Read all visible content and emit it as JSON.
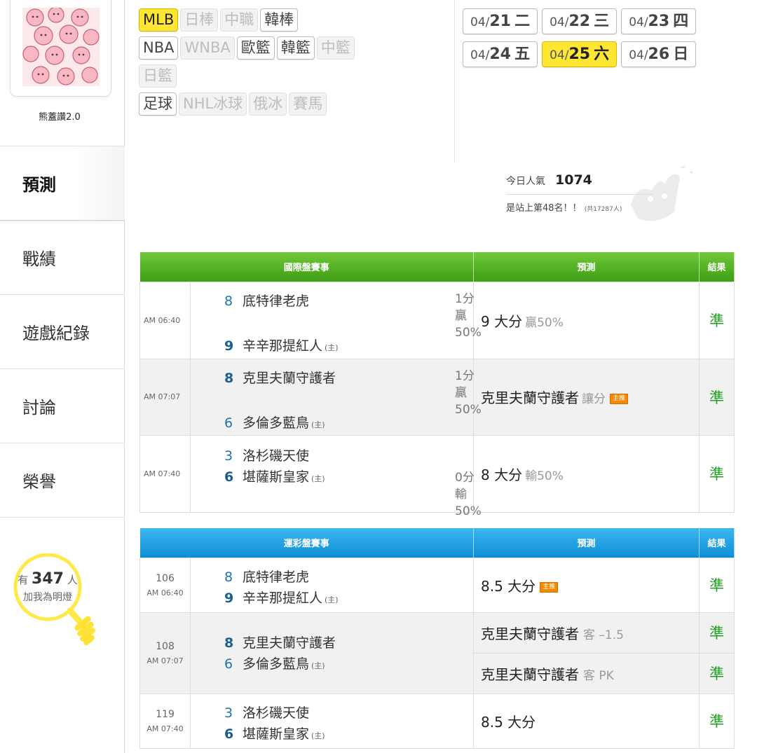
{
  "sidebar": {
    "username": "熊蓋讚2.0",
    "nav": [
      "預測",
      "戰績",
      "遊戲紀錄",
      "討論",
      "榮譽"
    ],
    "fans": {
      "prefix": "有",
      "count": "347",
      "suffix": "人",
      "line2": "加我為明燈"
    }
  },
  "leagues": [
    [
      {
        "label": "MLB",
        "state": "active"
      },
      {
        "label": "日棒",
        "state": "disabled"
      },
      {
        "label": "中職",
        "state": "disabled"
      },
      {
        "label": "韓棒",
        "state": "normal"
      }
    ],
    [
      {
        "label": "NBA",
        "state": "normal"
      },
      {
        "label": "WNBA",
        "state": "disabled"
      },
      {
        "label": "歐籃",
        "state": "normal"
      },
      {
        "label": "韓籃",
        "state": "normal"
      },
      {
        "label": "中籃",
        "state": "disabled"
      }
    ],
    [
      {
        "label": "日籃",
        "state": "disabled"
      }
    ],
    [
      {
        "label": "足球",
        "state": "normal"
      },
      {
        "label": "NHL冰球",
        "state": "disabled"
      },
      {
        "label": "俄冰",
        "state": "disabled"
      },
      {
        "label": "賽馬",
        "state": "disabled"
      }
    ]
  ],
  "dates": [
    {
      "md": "04/",
      "dd": "21",
      "wd": "二",
      "active": false
    },
    {
      "md": "04/",
      "dd": "22",
      "wd": "三",
      "active": false
    },
    {
      "md": "04/",
      "dd": "23",
      "wd": "四",
      "active": false
    },
    {
      "md": "04/",
      "dd": "24",
      "wd": "五",
      "active": false
    },
    {
      "md": "04/",
      "dd": "25",
      "wd": "六",
      "active": true
    },
    {
      "md": "04/",
      "dd": "26",
      "wd": "日",
      "active": false
    }
  ],
  "popularity": {
    "label": "今日人氣",
    "count": "1074",
    "rank": "是站上第48名！！",
    "total": "(共17287人)"
  },
  "intl": {
    "headers": {
      "event": "國際盤賽事",
      "pred": "預測",
      "result": "結果"
    },
    "rows": [
      {
        "time": "AM 06:40",
        "away_score": "8",
        "away": "底特律老虎",
        "home_score": "9",
        "home": "辛辛那提紅人",
        "home_tag": "(主)",
        "odds1": "1分贏",
        "odds2": "50%",
        "pred": "9 大分",
        "pred_sub": "贏50%",
        "badge": "",
        "result": "準"
      },
      {
        "time": "AM 07:07",
        "away_score": "8",
        "away": "克里夫蘭守護者",
        "home_score": "6",
        "home": "多倫多藍鳥",
        "home_tag": "(主)",
        "odds1": "1分贏",
        "odds2": "50%",
        "pred": "克里夫蘭守護者",
        "pred_sub": "讓分",
        "badge": "主推",
        "result": "準"
      },
      {
        "time": "AM 07:40",
        "away_score": "3",
        "away": "洛杉磯天使",
        "home_score": "6",
        "home": "堪薩斯皇家",
        "home_tag": "(主)",
        "odds1": "0分輸",
        "odds2": "50%",
        "pred": "8 大分",
        "pred_sub": "輸50%",
        "badge": "",
        "result": "準"
      }
    ]
  },
  "sport": {
    "headers": {
      "event": "運彩盤賽事",
      "pred": "預測",
      "result": "結果"
    },
    "rows": [
      {
        "no": "106",
        "time": "AM 06:40",
        "away_score": "8",
        "away": "底特律老虎",
        "home_score": "9",
        "home": "辛辛那提紅人",
        "home_tag": "(主)",
        "preds": [
          {
            "main": "8.5 大分",
            "sub": "",
            "badge": "主推",
            "result": "準"
          }
        ]
      },
      {
        "no": "108",
        "time": "AM 07:07",
        "away_score": "8",
        "away": "克里夫蘭守護者",
        "home_score": "6",
        "home": "多倫多藍鳥",
        "home_tag": "(主)",
        "preds": [
          {
            "main": "克里夫蘭守護者",
            "sub": "客 –1.5",
            "badge": "",
            "result": "準"
          },
          {
            "main": "克里夫蘭守護者",
            "sub": "客 PK",
            "badge": "",
            "result": "準"
          }
        ]
      },
      {
        "no": "119",
        "time": "AM 07:40",
        "away_score": "3",
        "away": "洛杉磯天使",
        "home_score": "6",
        "home": "堪薩斯皇家",
        "home_tag": "(主)",
        "preds": [
          {
            "main": "8.5 大分",
            "sub": "",
            "badge": "",
            "result": "準"
          }
        ]
      }
    ]
  },
  "colors": {
    "accent_yellow": "#ffe633",
    "green_header": "#4caf1e",
    "blue_header": "#1a9ee0",
    "result_green": "#20a020",
    "score_blue": "#2173a8"
  }
}
